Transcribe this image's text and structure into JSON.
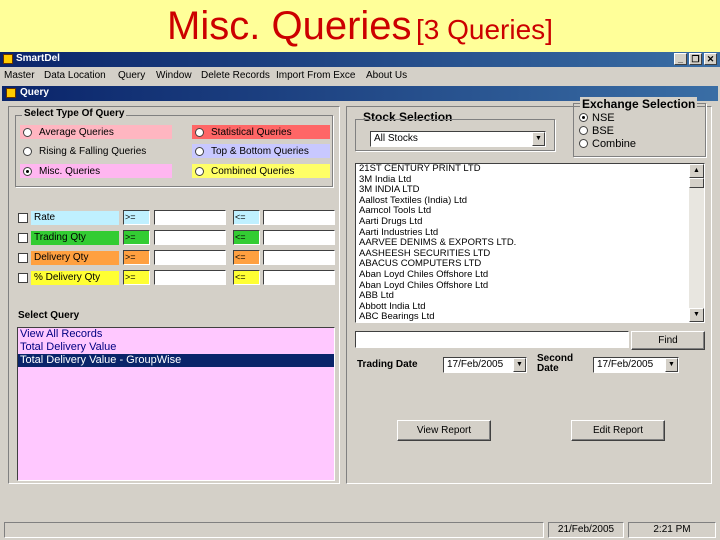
{
  "slide": {
    "title": "Misc. Queries",
    "subtitle": "[3 Queries]"
  },
  "app": {
    "title": "SmartDel"
  },
  "menu": [
    "Master",
    "Data Location",
    "Query",
    "Window",
    "Delete Records",
    "Import From Exce",
    "About Us"
  ],
  "child": {
    "title": "Query"
  },
  "query_type": {
    "label": "Select Type Of Query",
    "options": [
      {
        "label": "Average Queries",
        "color": "#ffb6c1",
        "selected": false
      },
      {
        "label": "Statistical Queries",
        "color": "#ff6666",
        "selected": false
      },
      {
        "label": "Rising & Falling Queries",
        "color": "#d4d0c8",
        "selected": false
      },
      {
        "label": "Top & Bottom Queries",
        "color": "#c8c8ff",
        "selected": false
      },
      {
        "label": "Misc. Queries",
        "color": "#ffb6f0",
        "selected": true
      },
      {
        "label": "Combined Queries",
        "color": "#ffff66",
        "selected": false
      }
    ]
  },
  "filters": [
    {
      "label": "Rate",
      "color": "#bff0ff",
      "op1": ">=",
      "op2": "<="
    },
    {
      "label": "Trading Qty",
      "color": "#33cc33",
      "op1": ">=",
      "op2": "<="
    },
    {
      "label": "Delivery Qty",
      "color": "#ffa040",
      "op1": ">=",
      "op2": "<="
    },
    {
      "label": "% Delivery Qty",
      "color": "#ffff33",
      "op1": ">=",
      "op2": "<="
    }
  ],
  "select_query": {
    "label": "Select Query",
    "items": [
      "View All Records",
      "Total Delivery Value",
      "Total Delivery Value - GroupWise"
    ],
    "selected_index": 2
  },
  "stock_selection": {
    "label": "Stock Selection",
    "combo_value": "All Stocks",
    "stocks": [
      "21ST CENTURY PRINT LTD",
      "3M India Ltd",
      "3M INDIA LTD",
      "Aallost Textiles (India) Ltd",
      "Aamcol Tools Ltd",
      "Aarti Drugs Ltd",
      "Aarti Industries Ltd",
      "AARVEE DENIMS & EXPORTS LTD.",
      "AASHEESH SECURITIES LTD",
      "ABACUS COMPUTERS LTD",
      "Aban Loyd Chiles Offshore Ltd",
      "Aban Loyd Chiles Offshore Ltd",
      "ABB Ltd",
      "Abbott India Ltd",
      "ABC Bearings Ltd"
    ]
  },
  "exchange": {
    "label": "Exchange Selection",
    "options": [
      {
        "label": "NSE",
        "selected": true
      },
      {
        "label": "BSE",
        "selected": false
      },
      {
        "label": "Combine",
        "selected": false
      }
    ]
  },
  "find": {
    "value": "",
    "button": "Find"
  },
  "dates": {
    "trading_label": "Trading Date",
    "trading_value": "17/Feb/2005",
    "second_label_1": "Second",
    "second_label_2": "Date",
    "second_value": "17/Feb/2005"
  },
  "buttons": {
    "view_report": "View Report",
    "edit_report": "Edit Report"
  },
  "status": {
    "date": "21/Feb/2005",
    "time": "2:21 PM"
  }
}
